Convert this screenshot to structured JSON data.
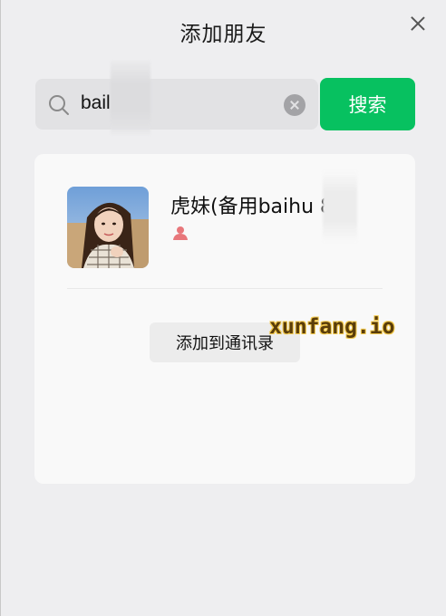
{
  "window": {
    "title": "添加朋友"
  },
  "search": {
    "query": "bail  787",
    "button_label": "搜索"
  },
  "result": {
    "name": "虎妹(备用baihu  81",
    "gender": "female",
    "add_button_label": "添加到通讯录"
  },
  "watermark": "xunfang.io",
  "colors": {
    "accent": "#07c160",
    "gender_icon": "#e8777b"
  },
  "icons": {
    "close": "close-icon",
    "search": "search-icon",
    "clear": "clear-icon",
    "gender": "female-user-icon"
  }
}
